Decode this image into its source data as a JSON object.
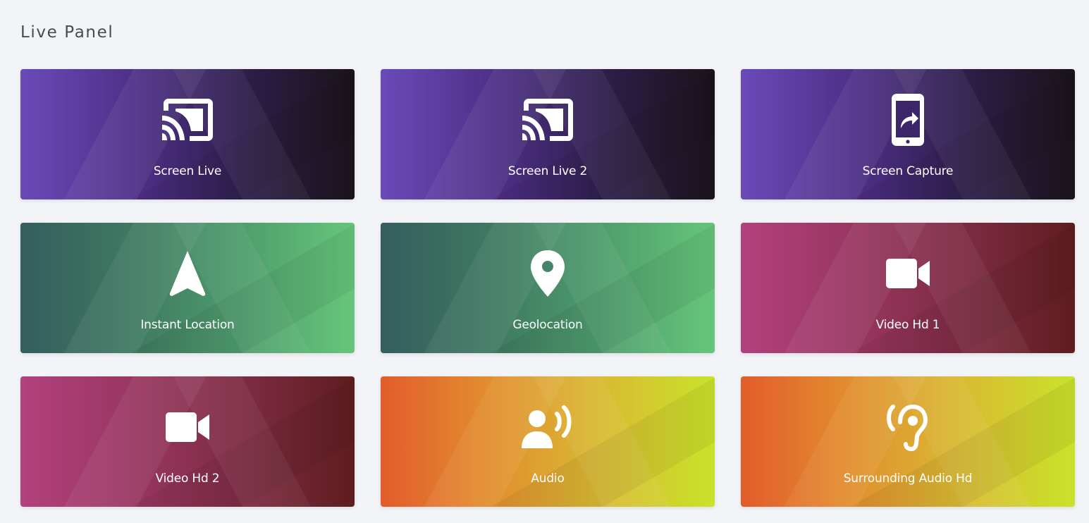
{
  "page": {
    "title": "Live Panel"
  },
  "tiles": [
    {
      "label": "Screen Live",
      "icon": "cast-icon",
      "theme": "purple",
      "color_from": "#6a4bb8",
      "color_to": "#1b1319"
    },
    {
      "label": "Screen Live 2",
      "icon": "cast-icon",
      "theme": "purple",
      "color_from": "#6a4bb8",
      "color_to": "#1b1319"
    },
    {
      "label": "Screen Capture",
      "icon": "phone-share-icon",
      "theme": "purple",
      "color_from": "#6a4bb8",
      "color_to": "#1b1319"
    },
    {
      "label": "Instant Location",
      "icon": "navigation-arrow-icon",
      "theme": "green",
      "color_from": "#355e5d",
      "color_to": "#66c67b"
    },
    {
      "label": "Geolocation",
      "icon": "map-pin-icon",
      "theme": "green",
      "color_from": "#355e5d",
      "color_to": "#66c67b"
    },
    {
      "label": "Video Hd 1",
      "icon": "video-camera-icon",
      "theme": "magenta",
      "color_from": "#b2417e",
      "color_to": "#5e1d1e"
    },
    {
      "label": "Video Hd 2",
      "icon": "video-camera-icon",
      "theme": "magenta",
      "color_from": "#b2417e",
      "color_to": "#5e1d1e"
    },
    {
      "label": "Audio",
      "icon": "person-speaking-icon",
      "theme": "orange",
      "color_from": "#e25c2c",
      "color_to": "#c9e32a"
    },
    {
      "label": "Surrounding Audio Hd",
      "icon": "ear-listening-icon",
      "theme": "orange",
      "color_from": "#e25c2c",
      "color_to": "#c9e32a"
    }
  ]
}
